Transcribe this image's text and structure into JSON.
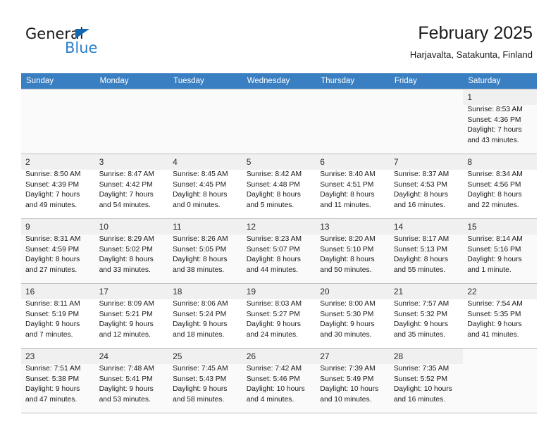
{
  "brand": {
    "name_dark": "General",
    "name_light": "Blue",
    "triangle_color": "#1269b0",
    "blue_color": "#2a7fc9"
  },
  "header": {
    "title": "February 2025",
    "subtitle": "Harjavalta, Satakunta, Finland"
  },
  "theme": {
    "header_row_bg": "#3a7fc1",
    "header_row_text": "#ffffff",
    "grid_border": "#bfbfbf",
    "daynum_bg": "#f0f0f0",
    "band_row_bg": "#fafafa"
  },
  "weekdays": [
    "Sunday",
    "Monday",
    "Tuesday",
    "Wednesday",
    "Thursday",
    "Friday",
    "Saturday"
  ],
  "labels": {
    "sunrise": "Sunrise:",
    "sunset": "Sunset:",
    "daylight": "Daylight:"
  },
  "weeks": [
    [
      {
        "empty": true
      },
      {
        "empty": true
      },
      {
        "empty": true
      },
      {
        "empty": true
      },
      {
        "empty": true
      },
      {
        "empty": true
      },
      {
        "day": "1",
        "sunrise": "Sunrise: 8:53 AM",
        "sunset": "Sunset: 4:36 PM",
        "daylight1": "Daylight: 7 hours",
        "daylight2": "and 43 minutes."
      }
    ],
    [
      {
        "day": "2",
        "sunrise": "Sunrise: 8:50 AM",
        "sunset": "Sunset: 4:39 PM",
        "daylight1": "Daylight: 7 hours",
        "daylight2": "and 49 minutes."
      },
      {
        "day": "3",
        "sunrise": "Sunrise: 8:47 AM",
        "sunset": "Sunset: 4:42 PM",
        "daylight1": "Daylight: 7 hours",
        "daylight2": "and 54 minutes."
      },
      {
        "day": "4",
        "sunrise": "Sunrise: 8:45 AM",
        "sunset": "Sunset: 4:45 PM",
        "daylight1": "Daylight: 8 hours",
        "daylight2": "and 0 minutes."
      },
      {
        "day": "5",
        "sunrise": "Sunrise: 8:42 AM",
        "sunset": "Sunset: 4:48 PM",
        "daylight1": "Daylight: 8 hours",
        "daylight2": "and 5 minutes."
      },
      {
        "day": "6",
        "sunrise": "Sunrise: 8:40 AM",
        "sunset": "Sunset: 4:51 PM",
        "daylight1": "Daylight: 8 hours",
        "daylight2": "and 11 minutes."
      },
      {
        "day": "7",
        "sunrise": "Sunrise: 8:37 AM",
        "sunset": "Sunset: 4:53 PM",
        "daylight1": "Daylight: 8 hours",
        "daylight2": "and 16 minutes."
      },
      {
        "day": "8",
        "sunrise": "Sunrise: 8:34 AM",
        "sunset": "Sunset: 4:56 PM",
        "daylight1": "Daylight: 8 hours",
        "daylight2": "and 22 minutes."
      }
    ],
    [
      {
        "day": "9",
        "sunrise": "Sunrise: 8:31 AM",
        "sunset": "Sunset: 4:59 PM",
        "daylight1": "Daylight: 8 hours",
        "daylight2": "and 27 minutes."
      },
      {
        "day": "10",
        "sunrise": "Sunrise: 8:29 AM",
        "sunset": "Sunset: 5:02 PM",
        "daylight1": "Daylight: 8 hours",
        "daylight2": "and 33 minutes."
      },
      {
        "day": "11",
        "sunrise": "Sunrise: 8:26 AM",
        "sunset": "Sunset: 5:05 PM",
        "daylight1": "Daylight: 8 hours",
        "daylight2": "and 38 minutes."
      },
      {
        "day": "12",
        "sunrise": "Sunrise: 8:23 AM",
        "sunset": "Sunset: 5:07 PM",
        "daylight1": "Daylight: 8 hours",
        "daylight2": "and 44 minutes."
      },
      {
        "day": "13",
        "sunrise": "Sunrise: 8:20 AM",
        "sunset": "Sunset: 5:10 PM",
        "daylight1": "Daylight: 8 hours",
        "daylight2": "and 50 minutes."
      },
      {
        "day": "14",
        "sunrise": "Sunrise: 8:17 AM",
        "sunset": "Sunset: 5:13 PM",
        "daylight1": "Daylight: 8 hours",
        "daylight2": "and 55 minutes."
      },
      {
        "day": "15",
        "sunrise": "Sunrise: 8:14 AM",
        "sunset": "Sunset: 5:16 PM",
        "daylight1": "Daylight: 9 hours",
        "daylight2": "and 1 minute."
      }
    ],
    [
      {
        "day": "16",
        "sunrise": "Sunrise: 8:11 AM",
        "sunset": "Sunset: 5:19 PM",
        "daylight1": "Daylight: 9 hours",
        "daylight2": "and 7 minutes."
      },
      {
        "day": "17",
        "sunrise": "Sunrise: 8:09 AM",
        "sunset": "Sunset: 5:21 PM",
        "daylight1": "Daylight: 9 hours",
        "daylight2": "and 12 minutes."
      },
      {
        "day": "18",
        "sunrise": "Sunrise: 8:06 AM",
        "sunset": "Sunset: 5:24 PM",
        "daylight1": "Daylight: 9 hours",
        "daylight2": "and 18 minutes."
      },
      {
        "day": "19",
        "sunrise": "Sunrise: 8:03 AM",
        "sunset": "Sunset: 5:27 PM",
        "daylight1": "Daylight: 9 hours",
        "daylight2": "and 24 minutes."
      },
      {
        "day": "20",
        "sunrise": "Sunrise: 8:00 AM",
        "sunset": "Sunset: 5:30 PM",
        "daylight1": "Daylight: 9 hours",
        "daylight2": "and 30 minutes."
      },
      {
        "day": "21",
        "sunrise": "Sunrise: 7:57 AM",
        "sunset": "Sunset: 5:32 PM",
        "daylight1": "Daylight: 9 hours",
        "daylight2": "and 35 minutes."
      },
      {
        "day": "22",
        "sunrise": "Sunrise: 7:54 AM",
        "sunset": "Sunset: 5:35 PM",
        "daylight1": "Daylight: 9 hours",
        "daylight2": "and 41 minutes."
      }
    ],
    [
      {
        "day": "23",
        "sunrise": "Sunrise: 7:51 AM",
        "sunset": "Sunset: 5:38 PM",
        "daylight1": "Daylight: 9 hours",
        "daylight2": "and 47 minutes."
      },
      {
        "day": "24",
        "sunrise": "Sunrise: 7:48 AM",
        "sunset": "Sunset: 5:41 PM",
        "daylight1": "Daylight: 9 hours",
        "daylight2": "and 53 minutes."
      },
      {
        "day": "25",
        "sunrise": "Sunrise: 7:45 AM",
        "sunset": "Sunset: 5:43 PM",
        "daylight1": "Daylight: 9 hours",
        "daylight2": "and 58 minutes."
      },
      {
        "day": "26",
        "sunrise": "Sunrise: 7:42 AM",
        "sunset": "Sunset: 5:46 PM",
        "daylight1": "Daylight: 10 hours",
        "daylight2": "and 4 minutes."
      },
      {
        "day": "27",
        "sunrise": "Sunrise: 7:39 AM",
        "sunset": "Sunset: 5:49 PM",
        "daylight1": "Daylight: 10 hours",
        "daylight2": "and 10 minutes."
      },
      {
        "day": "28",
        "sunrise": "Sunrise: 7:35 AM",
        "sunset": "Sunset: 5:52 PM",
        "daylight1": "Daylight: 10 hours",
        "daylight2": "and 16 minutes."
      },
      {
        "empty": true
      }
    ]
  ]
}
